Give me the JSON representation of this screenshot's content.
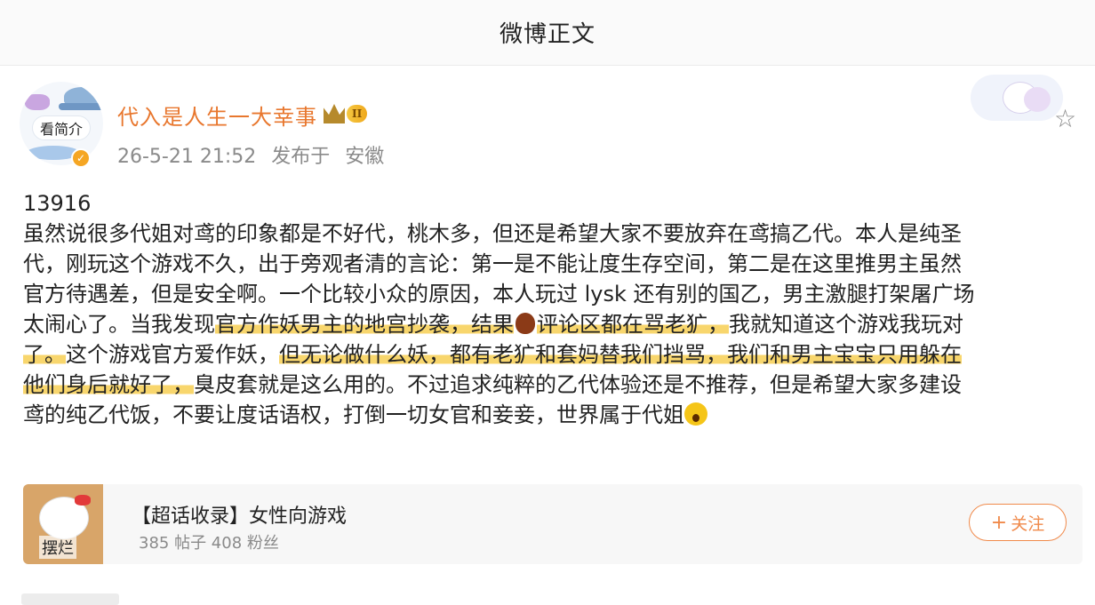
{
  "nav": {
    "title": "微博正文"
  },
  "author": {
    "avatar_label": "看简介",
    "name": "代入是人生一大幸事",
    "vip_level": "II",
    "timestamp": "26-5-21 21:52",
    "location_prefix": "发布于",
    "location": "安徽"
  },
  "post": {
    "id": "13916",
    "lines": [
      [
        "虽然说很多代姐对鸢的印象都是不好代，桃木多，但还是希望大家不要放弃在鸢搞乙代。本人是纯圣"
      ],
      [
        "代，刚玩这个游戏不久，出于旁观者清的言论：第一是不能让度生存空间，第二是在这里推男主虽然"
      ],
      [
        "官方待遇差，但是安全啊。一个比较小众的原因，本人玩过 lysk 还有别的国乙，男主激腿打架屠广场"
      ],
      [
        "太闹心了。当我发现",
        "官方作妖男主的地宫抄袭，结果",
        "评论区都在骂老犷，",
        "我就知道这个游戏我玩对"
      ],
      [
        "了。",
        "这个游戏官方爱作妖，",
        "但无论做什么妖，都有老犷和套妈替我们挡骂，",
        "我们和男主宝宝只用躲在"
      ],
      [
        "他们身后就好了，",
        "臭皮套就是这么用的。不过追求纯粹的乙代体验还是不推荐，但是希望大家多建设"
      ],
      [
        "鸢的纯乙代饭，不要让度话语权，打倒一切女官和妾妾，世界属于代姐"
      ]
    ]
  },
  "super_topic": {
    "thumb_label": "摆烂",
    "title": "【超话收录】女性向游戏",
    "stats": "385 帖子 408 粉丝",
    "follow_label": "关注"
  },
  "icons": {
    "star": "star-outline-icon",
    "verified": "verified-badge-icon",
    "vip": "vip-crown-icon",
    "chestnut": "chestnut-emoji-icon",
    "scream": "scream-emoji-icon"
  },
  "colors": {
    "username": "#e8772e",
    "highlight": "#f8d66d",
    "follow_accent": "#f08a4b",
    "meta_gray": "#8a8a8a"
  }
}
